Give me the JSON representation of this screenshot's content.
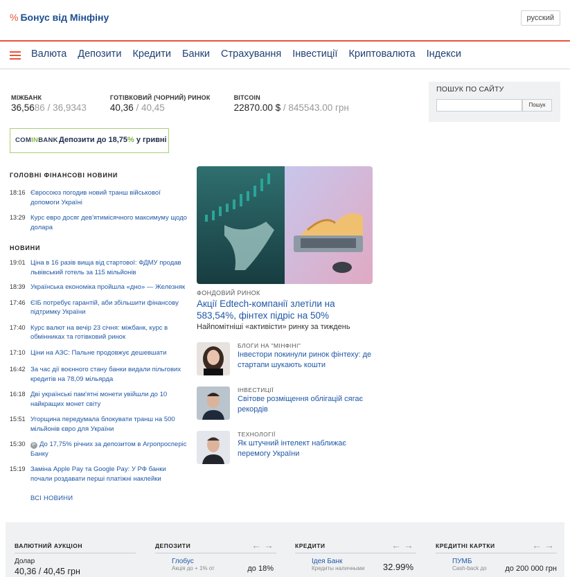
{
  "header": {
    "logo_icon": "%",
    "logo_text": "Бонус від Мінфіну",
    "lang_button": "русский",
    "accent_color": "#e5553b"
  },
  "nav": {
    "items": [
      "Валюта",
      "Депозити",
      "Кредити",
      "Банки",
      "Страхування",
      "Інвестиції",
      "Криптовалюта",
      "Індекси"
    ]
  },
  "rates": {
    "interbank": {
      "label": "МІЖБАНК",
      "buy_main": "36,56",
      "buy_dim": "86",
      "sep": " / ",
      "sell_main": "36,93",
      "sell_dim": "43"
    },
    "cash": {
      "label": "ГОТІВКОВИЙ (ЧОРНИЙ) РИНОК",
      "buy": "40,36",
      "sep": " / ",
      "sell": "40,45"
    },
    "bitcoin": {
      "label": "BITCOIN",
      "usd": "22870.00 $",
      "sep": " / ",
      "uah": "845543.00 грн"
    }
  },
  "search": {
    "label": "ПОШУК ПО САЙТУ",
    "placeholder": "",
    "button": "Пошук"
  },
  "promo": {
    "logo_left": "COM",
    "logo_in": "IN",
    "logo_right": "BANK",
    "text_a": "Депозити до 18,75",
    "text_pct": "%",
    "text_b": " у гривні"
  },
  "main_news": {
    "title": "ГОЛОВНІ ФІНАНСОВІ НОВИНИ",
    "items": [
      {
        "time": "18:16",
        "text": "Євросоюз погодив новий транш військової допомоги Україні"
      },
      {
        "time": "13:29",
        "text": "Курс евро досяг дев'ятимісячного максимуму щодо долара"
      }
    ]
  },
  "news": {
    "title": "НОВИНИ",
    "items": [
      {
        "time": "19:01",
        "text": "Ціна в 16 разів вища від стартової: ФДМУ продав львівський готель за 115 мільйонів"
      },
      {
        "time": "18:39",
        "text": "Українська економіка пройшла «дно» — Железняк"
      },
      {
        "time": "17:46",
        "text": "ЄІБ потребує гарантій, аби збільшити фінансову підтримку України"
      },
      {
        "time": "17:40",
        "text": "Курс валют на вечір 23 січня: міжбанк, курс в обмінниках та готівковий ринок"
      },
      {
        "time": "17:10",
        "text": "Ціни на АЗС: Пальне продовжує дешевшати"
      },
      {
        "time": "16:42",
        "text": "За час дії воєнного стану банки видали пільгових кредитів на 78,09 мільярда"
      },
      {
        "time": "16:18",
        "text": "Дві українські пам'ятні монети увійшли до 10 найкращих монет світу"
      },
      {
        "time": "15:51",
        "text": "Угорщина передумала блокувати транш на 500 мільйонів євро для України"
      },
      {
        "time": "15:30",
        "text": "До 17,75% річних за депозитом в Агропросперіс Банку",
        "sponsored": "P"
      },
      {
        "time": "15:19",
        "text": "Заміна Apple Pay та Google Pay: У РФ банки почали роздавати перші платіжні наклейки"
      }
    ],
    "all_link": "ВСІ НОВИНИ"
  },
  "featured": {
    "category": "ФОНДОВИЙ РИНОК",
    "title": "Акції Edtech-компанії злетіли на 583,54%, фінтех підріс на 50%",
    "subtitle": "Найпомітніші «активісти» ринку за тиждень"
  },
  "side_stories": [
    {
      "category": "БЛОГИ НА \"МІНФІНІ\"",
      "title": "Інвестори покинули ринок фінтеху: де стартапи шукають кошти"
    },
    {
      "category": "ІНВЕСТИЦІЇ",
      "title": "Світове розміщення облігацій сягає рекордів"
    },
    {
      "category": "ТЕХНОЛОГІЇ",
      "title": "Як штучний інтелект наближає перемогу України"
    }
  ],
  "widgets": {
    "auction": {
      "title": "ВАЛЮТНИЙ АУКЦІОН",
      "currency": "Долар",
      "rate": "40,36 / 40,45 грн"
    },
    "deposits": {
      "title": "ДЕПОЗИТИ",
      "arrows": "←→",
      "bank": "Глобус",
      "note": "Акцiя до + 1% от",
      "value": "до 18%"
    },
    "credits": {
      "title": "КРЕДИТИ",
      "arrows": "←→",
      "bank": "Ідея Банк",
      "note": "Кредиты наличными",
      "value": "32.99%"
    },
    "cards": {
      "title": "КРЕДИТНІ КАРТКИ",
      "arrows": "←→",
      "bank": "ПУМБ",
      "note": "Cash-back до",
      "value": "до 200 000 грн"
    }
  }
}
